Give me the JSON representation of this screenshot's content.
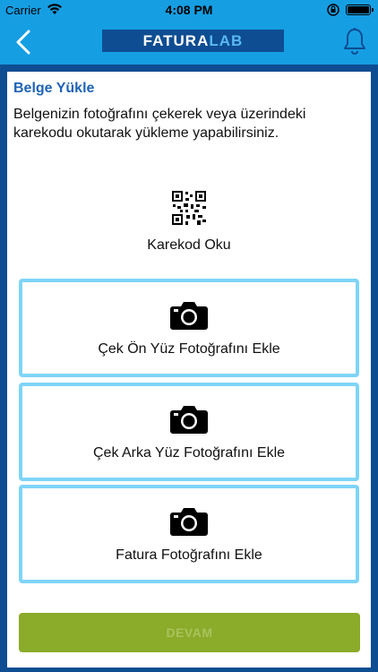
{
  "status_bar": {
    "carrier": "Carrier",
    "time": "4:08 PM",
    "icons": [
      "wifi-icon",
      "rotation-lock-icon",
      "battery-icon"
    ]
  },
  "header": {
    "logo_part1": "FATURA",
    "logo_part2": "LAB",
    "icons": [
      "back-arrow-icon",
      "bell-icon"
    ]
  },
  "upload": {
    "title": "Belge Yükle",
    "description": "Belgenizin fotoğrafını çekerek veya üzerindeki karekodu okutarak yükleme yapabilirsiniz.",
    "qr_label": "Karekod Oku",
    "cards": [
      {
        "label": "Çek Ön Yüz Fotoğrafını Ekle",
        "icon": "camera-icon"
      },
      {
        "label": "Çek Arka Yüz Fotoğrafını Ekle",
        "icon": "camera-icon"
      },
      {
        "label": "Fatura Fotoğrafını Ekle",
        "icon": "camera-icon"
      }
    ],
    "continue_label": "DEVAM"
  },
  "colors": {
    "header_blue": "#169ee3",
    "frame_navy": "#0e4d92",
    "card_border": "#7ed4f7",
    "button_green": "#8bab2b",
    "title_blue": "#1f63b5"
  }
}
